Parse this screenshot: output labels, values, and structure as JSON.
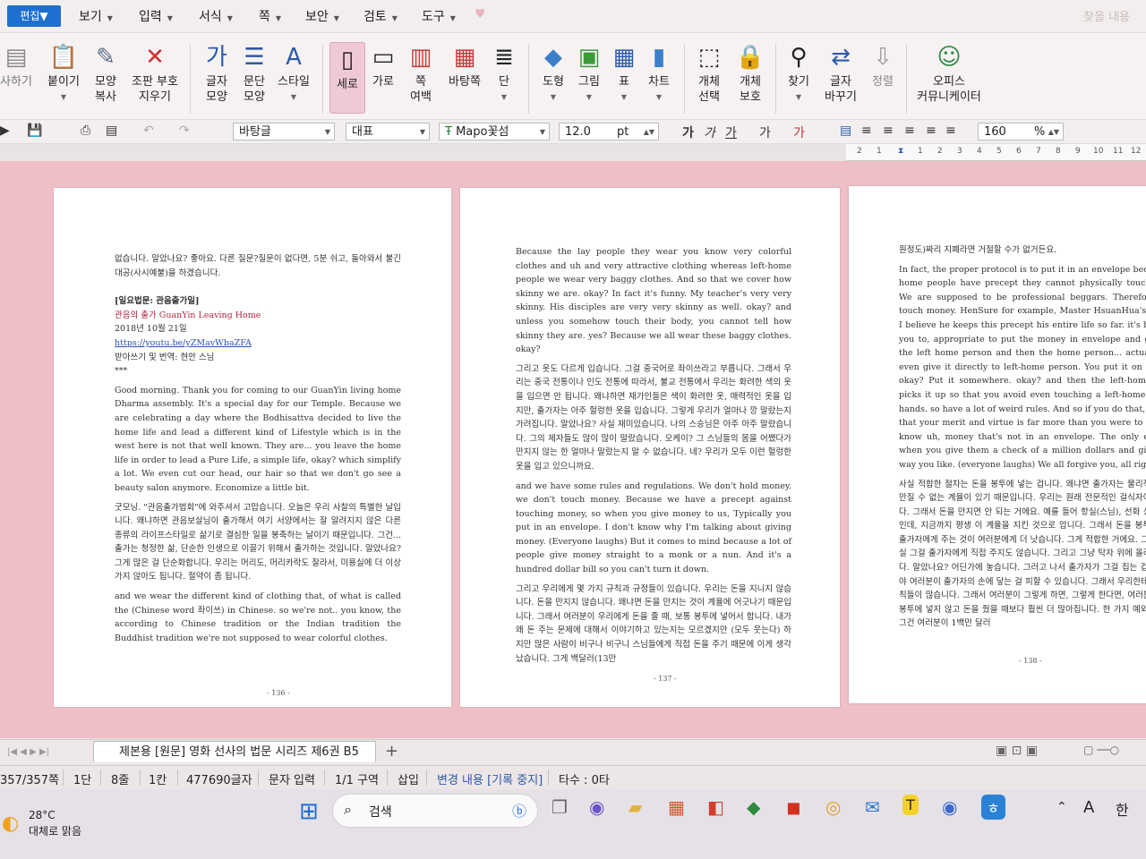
{
  "menu": {
    "items": [
      "편집",
      "보기",
      "입력",
      "서식",
      "쪽",
      "보안",
      "검토",
      "도구"
    ],
    "find_label": "찾을 내용"
  },
  "ribbon": {
    "copy_label": "사하기",
    "paste_label": "붙이기",
    "format_copy_label": "모양\n복사",
    "delete_marks_label": "조판 부호\n지우기",
    "char_shape_label": "글자\n모양",
    "para_shape_label": "문단\n모양",
    "style_label": "스타일",
    "vertical_label": "세로",
    "horizontal_label": "가로",
    "margin_label": "쪽\n여백",
    "background_label": "바탕쪽",
    "columns_label": "단",
    "shape_label": "도형",
    "picture_label": "그림",
    "table_label": "표",
    "chart_label": "차트",
    "object_select_label": "개체\n선택",
    "object_protect_label": "개체\n보호",
    "find_btn_label": "찾기",
    "replace_label": "글자\n바꾸기",
    "align_label": "정렬",
    "office_label": "오피스\n커뮤니케이터"
  },
  "format": {
    "font_set": "바탕글",
    "style": "대표",
    "font": "Mapo꽃섬",
    "font_size": "12.0",
    "unit": "pt",
    "zoom": "160",
    "zoom_unit": "%"
  },
  "ruler": {
    "numbers": [
      "2",
      "1",
      "1",
      "2",
      "3",
      "4",
      "5",
      "6",
      "7",
      "8",
      "9",
      "10",
      "11",
      "12"
    ]
  },
  "pages": [
    {
      "number": "- 136 -",
      "intro": "없습니다. 알았나요? 좋아요. 다른 질문?질문이 없다면, 5분 쉬고, 돌아와서 불긴대공(사시예불)을 하겠습니다.",
      "heading": "[일요법문: 관음출가일]",
      "subtitle": "관음의 출가 GuanYin Leaving Home",
      "date": "2018년 10월 21일",
      "url": "https://youtu.be/yZMavWbaZFA",
      "credit": "받아쓰기 및 번역: 현안 스님",
      "stars": "***",
      "para_en1": "Good morning. Thank you for coming to our GuanYin living home Dharma assembly. It's a special day for our Temple. Because we are celebrating a day where the Bodhisattva decided to live the home life and lead a different kind of Lifestyle which is in the west here is not that well known. They are... you leave the home life in order to lead a Pure Life, a simple life, okay? which simplify a lot. We even cut our head, our hair so that we don't go see a beauty salon anymore. Economize a little bit.",
      "para_ko1": "굿모닝. \"관음출가법회\"에 와주셔서 고맙습니다. 오늘은 우리 사찰의 특별한 날입니다. 왜냐하면 관음보살님이 출가해서 여기 서양에서는 잘 알려지지 않은 다른 종류의 라이프스타일로 삶기로 결심한 일을 봉축하는 날이기 때문입니다. 그건... 출가는 청정한 삶, 단순한 인생으로 이끌기 위해서 출가하는 것입니다. 알았나요? 그게 많은 걸 단순화합니다. 우리는 머리도, 머리카락도 잘라서, 미용실에 더 이상 가지 않아도 됩니다. 절약이 좀 됩니다.",
      "para_en2": "and we wear the different kind of clothing that, of what is called the (Chinese word 좌이쓰) in Chinese. so we're not.. you know, the according to Chinese tradition or the Indian tradition the Buddhist tradition we're not supposed to wear colorful clothes."
    },
    {
      "number": "- 137 -",
      "para_en1": "Because the lay people they wear you know very colorful clothes and uh and very attractive clothing whereas left-home people we wear very baggy clothes. And so that we cover how skinny we are. okay? In fact it's funny. My teacher's very very skinny. His disciples are very very skinny as well. okay? and unless you somehow touch their body, you cannot tell how skinny they are. yes? Because we all wear these baggy clothes. okay?",
      "para_ko1": "그리고 옷도 다르게 입습니다. 그걸 중국어로 좌이쓰라고 부릅니다. 그래서 우리는 중국 전통이나 인도 전통에 따라서, 불교 전통에서 우리는 화려한 색의 옷을 입으면 안 됩니다. 왜냐하면 재가인들은 색이 화려한 옷, 매력적인 옷을 입지만, 출가자는 아주 헐렁한 옷을 입습니다. 그렇게 우리가 얼마나 깡 말랐는지 가려집니다. 알았나요? 사실 재미있습니다. 나의 스승님은 아주 아주 말랐습니다. 그의 제자들도 많이 많이 말랐습니다. 오케이? 그 스님들의 몸을 어쨌다가 만지지 않는 한 얼마나 말랐는지 알 수 없습니다. 네? 우리가 모두 이런 헐렁한 옷을 입고 있으니까요.",
      "para_en2": "and we have some rules and regulations. We don't hold money. we don't touch money. Because we have a precept against touching money, so when you give money to us, Typically you put in an envelope. I don't know why I'm talking about giving money. (Everyone laughs) But it comes to mind because a lot of people give money straight to a monk or a nun. And it's a hundred dollar bill so you can't turn it down.",
      "para_ko2": "그리고 우리에게 몇 가지 규칙과 규정들이 있습니다. 우리는 돈을 지니지 않습니다. 돈을 만지지 않습니다. 왜냐면 돈을 만지는 것이 계율에 어긋나기 때문입니다. 그래서 여러분이 우리에게 돈을 줄 때, 보통 봉투에 넣어서 합니다. 내가 왜 돈 주는 문제에 대해서 이야기하고 있는지는 모르겠지만 (모두 웃는다) 하지만 많은 사람이 비구나 비구니 스님들에게 직접 돈을 주기 때문에 이게 생각났습니다. 그게 백달러(13만"
    },
    {
      "number": "- 138 -",
      "intro": "원정도)짜리 지폐라면 거절할 수가 없거든요.",
      "para_en1": "In fact, the proper protocol is to put it in an envelope because left home people have precept they cannot physically touch money. We are supposed to be professional beggars. Therefore, don't touch money. HenSure for example, Master HsuanHua's disciple, I believe he keeps this precept his entire life so far. it's better for you to, appropriate to put the money in envelope and give it to the left home person and then the home person... actually don't even give it directly to left-home person. You put it on the table okay? Put it somewhere. okay? and then the left-home person picks it up so that you avoid even touching a left-home person's hands. so have a lot of weird rules. And so if you do that, if you do that your merit and virtue is far more than you were to give, you know uh, money that's not in an envelope. The only exception when you give them a check of a million dollars and give it any way you like. (everyone laughs) We all forgive you, all right?",
      "para_ko1": "사실 적합한 절차는 돈을 봉투에 넣는 겁니다. 왜냐면 출가자는 물리적으로 돈을 만질 수 없는 계율이 있기 때문입니다. 우리는 원래 전문적인 걸식자이어야 합니다. 그래서 돈을 만지면 안 되는 거에요. 예를 들어 항실(스님), 선화 상인의 제자인데, 지금까지 평생 이 계율을 지킨 것으로 압니다. 그래서 돈을 봉투에 넣어서 출가자에게 주는 것이 여러분에게 더 낫습니다. 그게 적합한 거에요. 그런 다음 사실 그걸 출가자에게 직접 주지도 않습니다. 그리고 그냥 탁자 위에 올려놓는 겁니다. 알았나요? 어딘가에 놓습니다. 그러고 나서 출가자가 그걸 집는 겁니다. 그래야 여러분이 출가자의 손에 닿는 걸 피할 수 있습니다. 그래서 우리한테 괴상한 규칙들이 많습니다. 그래서 여러분이 그렇게 하면, 그렇게 한다면, 여러분의 공덕이 봉투에 넣지 않고 돈을 줬을 때보다 훨씬 더 많아집니다. 한 가지 예외가 있는데, 그건 여러분이 1백만 달러"
    }
  ],
  "doc_tab": {
    "title": "제본용 [원문] 영화 선사의 법문 시리즈 제6권 B5",
    "add": "+"
  },
  "status": {
    "pages": "357/357쪽",
    "col": "1단",
    "line": "8줄",
    "cell": "1칸",
    "chars": "477690글자",
    "mode": "문자 입력",
    "section": "1/1 구역",
    "insert": "삽입",
    "track": "변경 내용 [기록 중지]",
    "typos": "타수 : 0타"
  },
  "taskbar": {
    "temp": "28°C",
    "weather": "대체로 맑음",
    "search": "검색",
    "ime_a": "A",
    "ime_han": "한"
  },
  "colors": {
    "accent": "#1e6fd0",
    "doc_bg": "#eebfc7",
    "heading_red": "#b0233c"
  }
}
